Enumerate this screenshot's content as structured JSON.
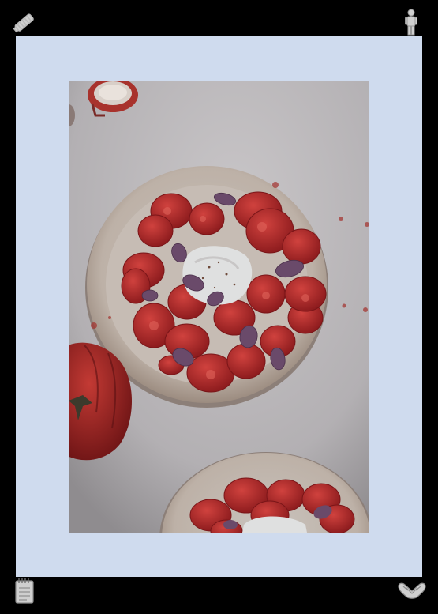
{
  "icons": {
    "top_left": "paint-roller-icon",
    "top_right": "standing-figure-icon",
    "bottom_left": "notepad-icon",
    "bottom_right": "clasped-hands-icon"
  },
  "colors": {
    "background": "#000000",
    "mat": "#cfdbee",
    "table_surface": "#b9b6b8",
    "plate": "#cbbdb3",
    "tomato": "#b5292a",
    "burrata": "#dfe0e0",
    "basil": "#6a4a6a"
  },
  "photo": {
    "subject": "tomato-burrata-salad"
  }
}
